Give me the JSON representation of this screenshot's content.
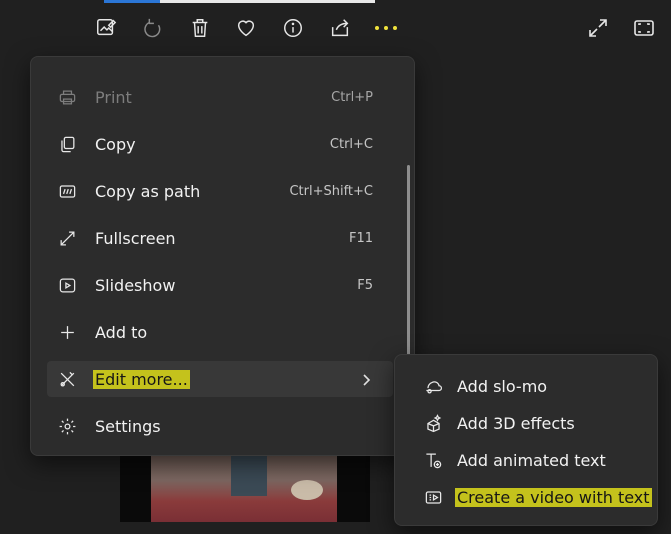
{
  "toolbar": {
    "icons": [
      "edit-image-icon",
      "rotate-icon",
      "delete-icon",
      "favorite-icon",
      "info-icon",
      "share-icon",
      "more-icon"
    ],
    "right_icons": [
      "fullscreen-icon",
      "fit-icon"
    ],
    "more_color": "#f0e33c"
  },
  "menu": {
    "items": [
      {
        "label": "Print",
        "shortcut": "Ctrl+P",
        "icon": "print-icon",
        "disabled": true
      },
      {
        "label": "Copy",
        "shortcut": "Ctrl+C",
        "icon": "copy-icon"
      },
      {
        "label": "Copy as path",
        "shortcut": "Ctrl+Shift+C",
        "icon": "copy-path-icon"
      },
      {
        "label": "Fullscreen",
        "shortcut": "F11",
        "icon": "fullscreen-icon"
      },
      {
        "label": "Slideshow",
        "shortcut": "F5",
        "icon": "slideshow-icon"
      },
      {
        "label": "Add to",
        "shortcut": "",
        "icon": "plus-icon"
      },
      {
        "label": "Edit more...",
        "shortcut": "",
        "icon": "edit-more-icon",
        "has_submenu": true,
        "active": true
      },
      {
        "label": "Settings",
        "shortcut": "",
        "icon": "settings-icon"
      }
    ]
  },
  "submenu": {
    "items": [
      {
        "label": "Add slo-mo",
        "icon": "slo-mo-icon"
      },
      {
        "label": "Add 3D effects",
        "icon": "3d-effects-icon"
      },
      {
        "label": "Add animated text",
        "icon": "animated-text-icon"
      },
      {
        "label": "Create a video with text",
        "icon": "video-text-icon",
        "highlighted": true
      }
    ]
  },
  "colors": {
    "accent_highlight": "#f7f735",
    "background": "#202020",
    "menu_bg": "#2c2c2c"
  }
}
